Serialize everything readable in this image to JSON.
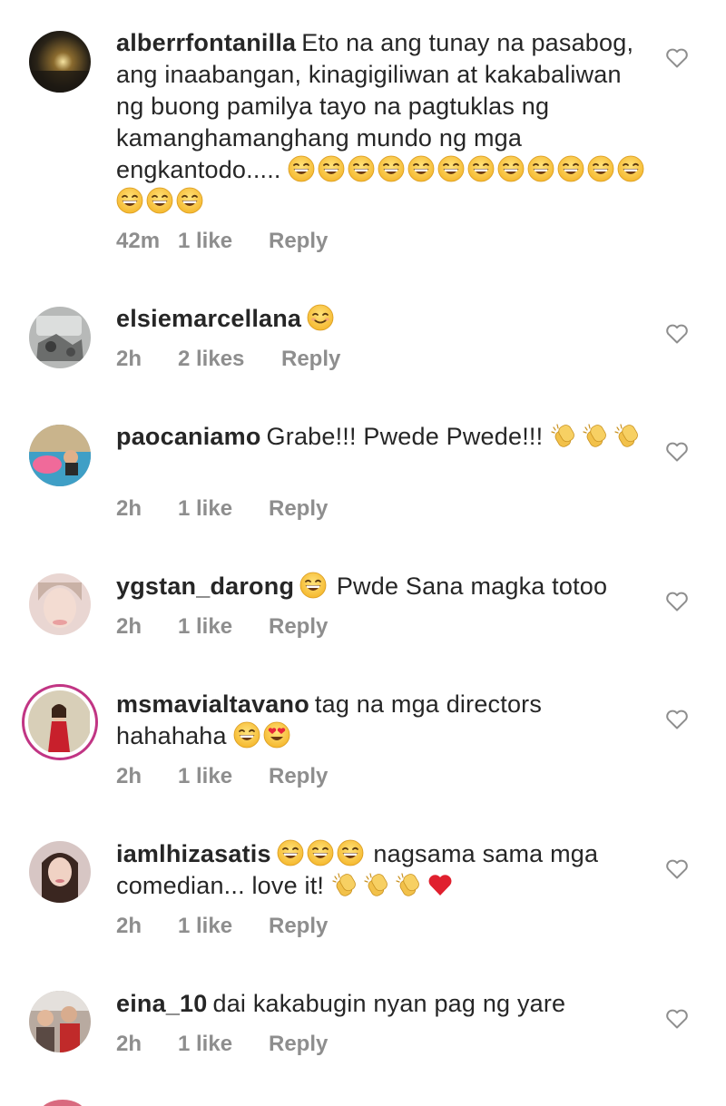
{
  "comments": [
    {
      "username": "alberrfontanilla",
      "text": "Eto na ang tunay na pasabog, ang inaabangan, kinagigiliwan at kakabaliwan ng buong pamilya tayo na pagtuklas ng kamanghamanghang mundo ng mga engkantodo.....",
      "emojis": [
        "grin",
        "grin",
        "grin",
        "grin",
        "grin",
        "grin",
        "grin",
        "grin",
        "grin",
        "grin",
        "grin",
        "grin",
        "grin",
        "grin",
        "grin"
      ],
      "time": "42m",
      "likes": "1 like",
      "reply": "Reply"
    },
    {
      "username": "elsiemarcellana",
      "text": "",
      "emojis": [
        "smile"
      ],
      "time": "2h",
      "likes": "2 likes",
      "reply": "Reply"
    },
    {
      "username": "paocaniamo",
      "text": "Grabe!!! Pwede Pwede!!!",
      "emojis": [
        "clap",
        "clap",
        "clap"
      ],
      "time": "2h",
      "likes": "1 like",
      "reply": "Reply"
    },
    {
      "username": "ygstan_darong",
      "text_before": "",
      "emojis": [
        "grin"
      ],
      "text": "Pwde Sana magka totoo",
      "time": "2h",
      "likes": "1 like",
      "reply": "Reply"
    },
    {
      "username": "msmavialtavano",
      "text": "tag na mga directors hahahaha",
      "emojis": [
        "grin",
        "hearteyes"
      ],
      "time": "2h",
      "likes": "1 like",
      "reply": "Reply"
    },
    {
      "username": "iamlhizasatis",
      "emojis_before": [
        "grin",
        "grin",
        "grin"
      ],
      "text": "nagsama sama mga comedian... love it!",
      "emojis": [
        "clap",
        "clap",
        "clap",
        "heart"
      ],
      "time": "2h",
      "likes": "1 like",
      "reply": "Reply"
    },
    {
      "username": "eina_10",
      "text": "dai kakabugin nyan pag ng yare",
      "emojis": [],
      "time": "2h",
      "likes": "1 like",
      "reply": "Reply"
    }
  ],
  "icons": {
    "like": "heart-outline-icon"
  },
  "colors": {
    "meta": "#8e8e8e",
    "text": "#262626",
    "story_ring": "#c13584"
  }
}
